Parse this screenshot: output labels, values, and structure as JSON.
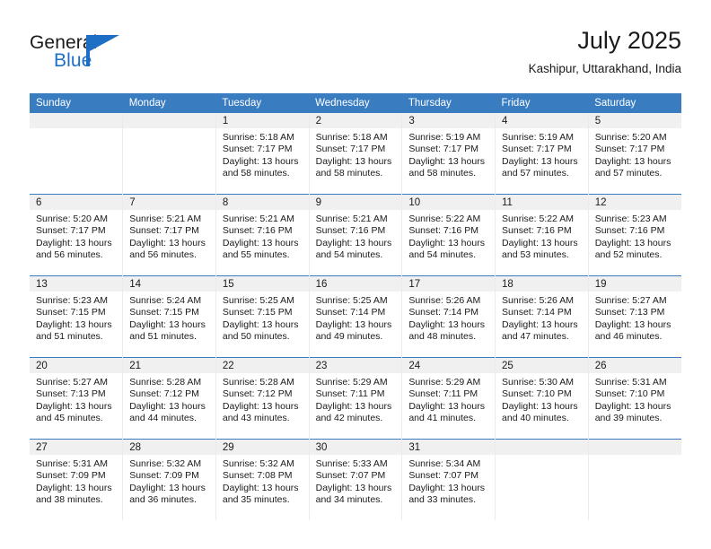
{
  "logo": {
    "word_one": "General",
    "word_two": "Blue",
    "accent_color": "#1c6fc4",
    "triangle_icon": "triangle-flag-icon"
  },
  "header": {
    "title": "July 2025",
    "subtitle": "Kashipur, Uttarakhand, India"
  },
  "theme": {
    "header_blue": "#3a7cc0",
    "daynum_band": "#f0f0f0",
    "text": "#1a1a1a"
  },
  "weekdays": [
    "Sunday",
    "Monday",
    "Tuesday",
    "Wednesday",
    "Thursday",
    "Friday",
    "Saturday"
  ],
  "labels": {
    "sunrise_prefix": "Sunrise:",
    "sunset_prefix": "Sunset:",
    "daylight_prefix": "Daylight:"
  },
  "weeks": [
    [
      {
        "day": "",
        "sunrise": "",
        "sunset": "",
        "daylight_line1": "",
        "daylight_line2": ""
      },
      {
        "day": "",
        "sunrise": "",
        "sunset": "",
        "daylight_line1": "",
        "daylight_line2": ""
      },
      {
        "day": "1",
        "sunrise": "Sunrise: 5:18 AM",
        "sunset": "Sunset: 7:17 PM",
        "daylight_line1": "Daylight: 13 hours",
        "daylight_line2": "and 58 minutes."
      },
      {
        "day": "2",
        "sunrise": "Sunrise: 5:18 AM",
        "sunset": "Sunset: 7:17 PM",
        "daylight_line1": "Daylight: 13 hours",
        "daylight_line2": "and 58 minutes."
      },
      {
        "day": "3",
        "sunrise": "Sunrise: 5:19 AM",
        "sunset": "Sunset: 7:17 PM",
        "daylight_line1": "Daylight: 13 hours",
        "daylight_line2": "and 58 minutes."
      },
      {
        "day": "4",
        "sunrise": "Sunrise: 5:19 AM",
        "sunset": "Sunset: 7:17 PM",
        "daylight_line1": "Daylight: 13 hours",
        "daylight_line2": "and 57 minutes."
      },
      {
        "day": "5",
        "sunrise": "Sunrise: 5:20 AM",
        "sunset": "Sunset: 7:17 PM",
        "daylight_line1": "Daylight: 13 hours",
        "daylight_line2": "and 57 minutes."
      }
    ],
    [
      {
        "day": "6",
        "sunrise": "Sunrise: 5:20 AM",
        "sunset": "Sunset: 7:17 PM",
        "daylight_line1": "Daylight: 13 hours",
        "daylight_line2": "and 56 minutes."
      },
      {
        "day": "7",
        "sunrise": "Sunrise: 5:21 AM",
        "sunset": "Sunset: 7:17 PM",
        "daylight_line1": "Daylight: 13 hours",
        "daylight_line2": "and 56 minutes."
      },
      {
        "day": "8",
        "sunrise": "Sunrise: 5:21 AM",
        "sunset": "Sunset: 7:16 PM",
        "daylight_line1": "Daylight: 13 hours",
        "daylight_line2": "and 55 minutes."
      },
      {
        "day": "9",
        "sunrise": "Sunrise: 5:21 AM",
        "sunset": "Sunset: 7:16 PM",
        "daylight_line1": "Daylight: 13 hours",
        "daylight_line2": "and 54 minutes."
      },
      {
        "day": "10",
        "sunrise": "Sunrise: 5:22 AM",
        "sunset": "Sunset: 7:16 PM",
        "daylight_line1": "Daylight: 13 hours",
        "daylight_line2": "and 54 minutes."
      },
      {
        "day": "11",
        "sunrise": "Sunrise: 5:22 AM",
        "sunset": "Sunset: 7:16 PM",
        "daylight_line1": "Daylight: 13 hours",
        "daylight_line2": "and 53 minutes."
      },
      {
        "day": "12",
        "sunrise": "Sunrise: 5:23 AM",
        "sunset": "Sunset: 7:16 PM",
        "daylight_line1": "Daylight: 13 hours",
        "daylight_line2": "and 52 minutes."
      }
    ],
    [
      {
        "day": "13",
        "sunrise": "Sunrise: 5:23 AM",
        "sunset": "Sunset: 7:15 PM",
        "daylight_line1": "Daylight: 13 hours",
        "daylight_line2": "and 51 minutes."
      },
      {
        "day": "14",
        "sunrise": "Sunrise: 5:24 AM",
        "sunset": "Sunset: 7:15 PM",
        "daylight_line1": "Daylight: 13 hours",
        "daylight_line2": "and 51 minutes."
      },
      {
        "day": "15",
        "sunrise": "Sunrise: 5:25 AM",
        "sunset": "Sunset: 7:15 PM",
        "daylight_line1": "Daylight: 13 hours",
        "daylight_line2": "and 50 minutes."
      },
      {
        "day": "16",
        "sunrise": "Sunrise: 5:25 AM",
        "sunset": "Sunset: 7:14 PM",
        "daylight_line1": "Daylight: 13 hours",
        "daylight_line2": "and 49 minutes."
      },
      {
        "day": "17",
        "sunrise": "Sunrise: 5:26 AM",
        "sunset": "Sunset: 7:14 PM",
        "daylight_line1": "Daylight: 13 hours",
        "daylight_line2": "and 48 minutes."
      },
      {
        "day": "18",
        "sunrise": "Sunrise: 5:26 AM",
        "sunset": "Sunset: 7:14 PM",
        "daylight_line1": "Daylight: 13 hours",
        "daylight_line2": "and 47 minutes."
      },
      {
        "day": "19",
        "sunrise": "Sunrise: 5:27 AM",
        "sunset": "Sunset: 7:13 PM",
        "daylight_line1": "Daylight: 13 hours",
        "daylight_line2": "and 46 minutes."
      }
    ],
    [
      {
        "day": "20",
        "sunrise": "Sunrise: 5:27 AM",
        "sunset": "Sunset: 7:13 PM",
        "daylight_line1": "Daylight: 13 hours",
        "daylight_line2": "and 45 minutes."
      },
      {
        "day": "21",
        "sunrise": "Sunrise: 5:28 AM",
        "sunset": "Sunset: 7:12 PM",
        "daylight_line1": "Daylight: 13 hours",
        "daylight_line2": "and 44 minutes."
      },
      {
        "day": "22",
        "sunrise": "Sunrise: 5:28 AM",
        "sunset": "Sunset: 7:12 PM",
        "daylight_line1": "Daylight: 13 hours",
        "daylight_line2": "and 43 minutes."
      },
      {
        "day": "23",
        "sunrise": "Sunrise: 5:29 AM",
        "sunset": "Sunset: 7:11 PM",
        "daylight_line1": "Daylight: 13 hours",
        "daylight_line2": "and 42 minutes."
      },
      {
        "day": "24",
        "sunrise": "Sunrise: 5:29 AM",
        "sunset": "Sunset: 7:11 PM",
        "daylight_line1": "Daylight: 13 hours",
        "daylight_line2": "and 41 minutes."
      },
      {
        "day": "25",
        "sunrise": "Sunrise: 5:30 AM",
        "sunset": "Sunset: 7:10 PM",
        "daylight_line1": "Daylight: 13 hours",
        "daylight_line2": "and 40 minutes."
      },
      {
        "day": "26",
        "sunrise": "Sunrise: 5:31 AM",
        "sunset": "Sunset: 7:10 PM",
        "daylight_line1": "Daylight: 13 hours",
        "daylight_line2": "and 39 minutes."
      }
    ],
    [
      {
        "day": "27",
        "sunrise": "Sunrise: 5:31 AM",
        "sunset": "Sunset: 7:09 PM",
        "daylight_line1": "Daylight: 13 hours",
        "daylight_line2": "and 38 minutes."
      },
      {
        "day": "28",
        "sunrise": "Sunrise: 5:32 AM",
        "sunset": "Sunset: 7:09 PM",
        "daylight_line1": "Daylight: 13 hours",
        "daylight_line2": "and 36 minutes."
      },
      {
        "day": "29",
        "sunrise": "Sunrise: 5:32 AM",
        "sunset": "Sunset: 7:08 PM",
        "daylight_line1": "Daylight: 13 hours",
        "daylight_line2": "and 35 minutes."
      },
      {
        "day": "30",
        "sunrise": "Sunrise: 5:33 AM",
        "sunset": "Sunset: 7:07 PM",
        "daylight_line1": "Daylight: 13 hours",
        "daylight_line2": "and 34 minutes."
      },
      {
        "day": "31",
        "sunrise": "Sunrise: 5:34 AM",
        "sunset": "Sunset: 7:07 PM",
        "daylight_line1": "Daylight: 13 hours",
        "daylight_line2": "and 33 minutes."
      },
      {
        "day": "",
        "sunrise": "",
        "sunset": "",
        "daylight_line1": "",
        "daylight_line2": ""
      },
      {
        "day": "",
        "sunrise": "",
        "sunset": "",
        "daylight_line1": "",
        "daylight_line2": ""
      }
    ]
  ]
}
